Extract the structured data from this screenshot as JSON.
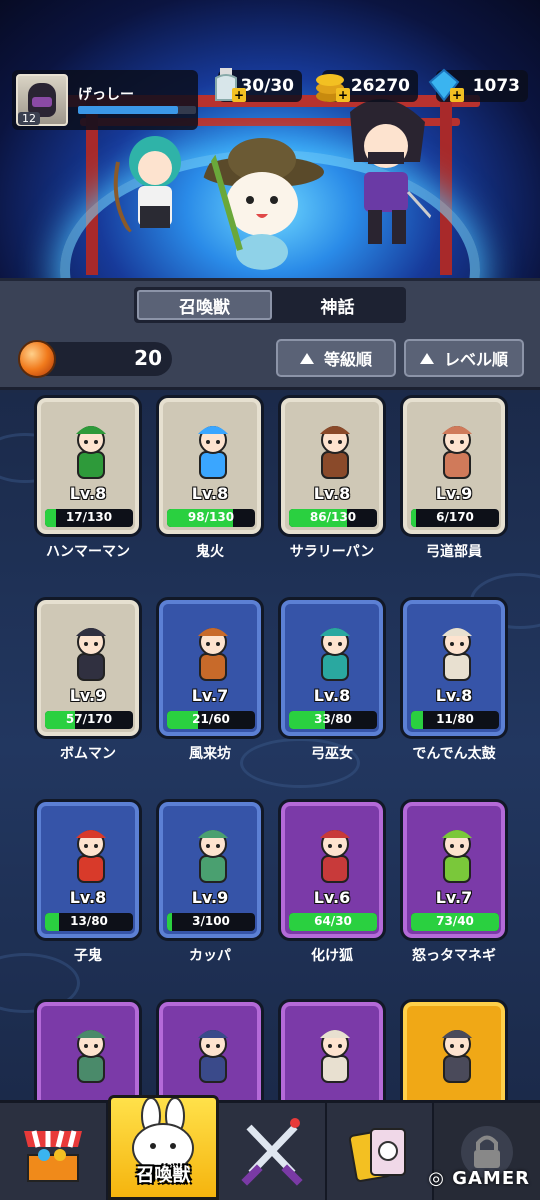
{
  "player": {
    "name": "げっしー",
    "level": "12",
    "xp_fraction": 0.85
  },
  "resources": [
    {
      "id": "stamina",
      "value": "30/30",
      "icon": "bottle-icon"
    },
    {
      "id": "coins",
      "value": "26270",
      "icon": "coin-stack-icon"
    },
    {
      "id": "gems",
      "value": "1073",
      "icon": "blue-gem-icon"
    }
  ],
  "tabs": [
    {
      "label": "召喚獣",
      "active": true
    },
    {
      "label": "神話",
      "active": false
    }
  ],
  "orb_count": "20",
  "sort_buttons": [
    {
      "label": "等級順"
    },
    {
      "label": "レベル順"
    }
  ],
  "cards": [
    {
      "name": "ハンマーマン",
      "level": "Lv.8",
      "progress": "17/130",
      "fill": 0.13,
      "rarity": "gray",
      "upgrade": false,
      "color": "#2e9a3a"
    },
    {
      "name": "鬼火",
      "level": "Lv.8",
      "progress": "98/130",
      "fill": 0.75,
      "rarity": "gray",
      "upgrade": false,
      "color": "#3aa6ff"
    },
    {
      "name": "サラリーパン",
      "level": "Lv.8",
      "progress": "86/130",
      "fill": 0.66,
      "rarity": "gray",
      "upgrade": false,
      "color": "#8a4a2a"
    },
    {
      "name": "弓道部員",
      "level": "Lv.9",
      "progress": "6/170",
      "fill": 0.04,
      "rarity": "gray",
      "upgrade": false,
      "color": "#d07a5a"
    },
    {
      "name": "ボムマン",
      "level": "Lv.9",
      "progress": "57/170",
      "fill": 0.34,
      "rarity": "gray",
      "upgrade": false,
      "color": "#303040"
    },
    {
      "name": "風来坊",
      "level": "Lv.7",
      "progress": "21/60",
      "fill": 0.35,
      "rarity": "blue",
      "upgrade": false,
      "color": "#c86a2a"
    },
    {
      "name": "弓巫女",
      "level": "Lv.8",
      "progress": "33/80",
      "fill": 0.41,
      "rarity": "blue",
      "upgrade": false,
      "color": "#2aa8a0"
    },
    {
      "name": "でんでん太鼓",
      "level": "Lv.8",
      "progress": "11/80",
      "fill": 0.14,
      "rarity": "blue",
      "upgrade": false,
      "color": "#e8e0d0"
    },
    {
      "name": "子鬼",
      "level": "Lv.8",
      "progress": "13/80",
      "fill": 0.16,
      "rarity": "blue",
      "upgrade": false,
      "color": "#d83a2a"
    },
    {
      "name": "カッパ",
      "level": "Lv.9",
      "progress": "3/100",
      "fill": 0.03,
      "rarity": "blue",
      "upgrade": false,
      "color": "#4aa070"
    },
    {
      "name": "化け狐",
      "level": "Lv.6",
      "progress": "64/30",
      "fill": 1.0,
      "rarity": "purple",
      "upgrade": true,
      "color": "#c83a3a"
    },
    {
      "name": "怒っタマネギ",
      "level": "Lv.7",
      "progress": "73/40",
      "fill": 1.0,
      "rarity": "purple",
      "upgrade": true,
      "color": "#7ac83a"
    },
    {
      "name": "",
      "level": "",
      "progress": "",
      "fill": 0,
      "rarity": "purple",
      "upgrade": false,
      "color": "#4a8a6a"
    },
    {
      "name": "",
      "level": "",
      "progress": "",
      "fill": 0,
      "rarity": "purple",
      "upgrade": false,
      "color": "#3a4a8a"
    },
    {
      "name": "",
      "level": "",
      "progress": "",
      "fill": 0,
      "rarity": "purple",
      "upgrade": false,
      "color": "#e8e0d0"
    },
    {
      "name": "",
      "level": "",
      "progress": "",
      "fill": 0,
      "rarity": "gold",
      "upgrade": false,
      "color": "#4a4a5a"
    }
  ],
  "bottom_nav": [
    {
      "id": "shop",
      "label": "",
      "icon": "shop-stall-icon"
    },
    {
      "id": "summon",
      "label": "召喚獣",
      "icon": "rabbit-icon",
      "active": true
    },
    {
      "id": "battle",
      "label": "",
      "icon": "crossed-swords-icon"
    },
    {
      "id": "cards",
      "label": "",
      "icon": "cards-icon"
    },
    {
      "id": "locked",
      "label": "",
      "icon": "lock-icon"
    }
  ],
  "watermark": "GAMER"
}
